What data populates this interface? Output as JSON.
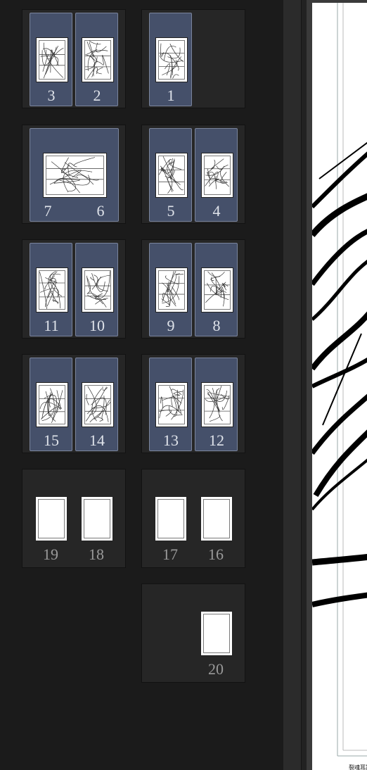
{
  "pages": {
    "p1": "1",
    "p2": "2",
    "p3": "3",
    "p4": "4",
    "p5": "5",
    "p6": "6",
    "p7": "7",
    "p8": "8",
    "p9": "9",
    "p10": "10",
    "p11": "11",
    "p12": "12",
    "p13": "13",
    "p14": "14",
    "p15": "15",
    "p16": "16",
    "p17": "17",
    "p18": "18",
    "p19": "19",
    "p20": "20"
  },
  "canvas": {
    "footer_label": "裂魂耳語"
  },
  "colors": {
    "selected_page": "#45506a",
    "spread_bg": "#262626",
    "panel_bg": "#1b1b1b",
    "page_number_selected": "#dfe3ea",
    "page_number_plain": "#9a9a9a"
  }
}
